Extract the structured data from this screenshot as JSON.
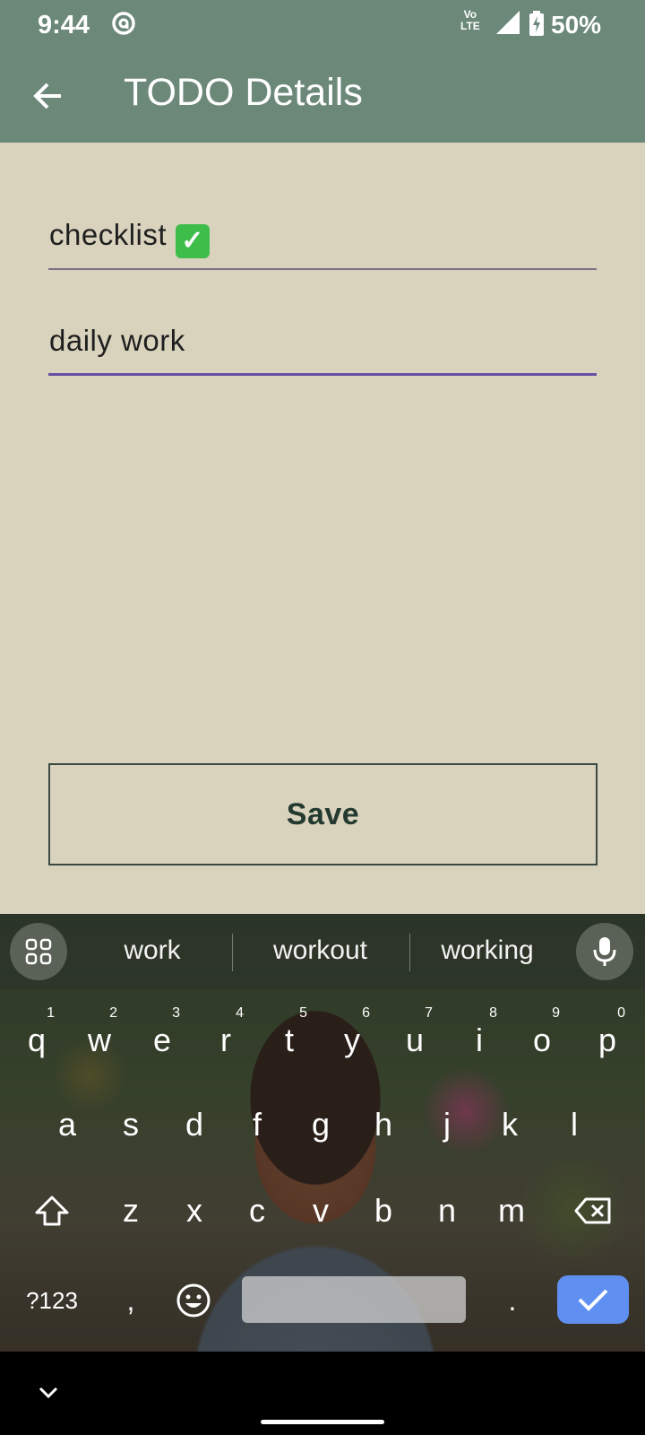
{
  "status_bar": {
    "time": "9:44",
    "volte_top": "Vo",
    "volte_bottom": "LTE",
    "battery": "50%"
  },
  "app_bar": {
    "title": "TODO Details",
    "back_icon": "arrow-left-icon"
  },
  "form": {
    "title_value": "checklist",
    "title_emoji": "✓",
    "description_value": "daily work",
    "save_label": "Save"
  },
  "keyboard": {
    "suggestions": [
      "work",
      "workout",
      "working"
    ],
    "row1": [
      {
        "key": "q",
        "num": "1"
      },
      {
        "key": "w",
        "num": "2"
      },
      {
        "key": "e",
        "num": "3"
      },
      {
        "key": "r",
        "num": "4"
      },
      {
        "key": "t",
        "num": "5"
      },
      {
        "key": "y",
        "num": "6"
      },
      {
        "key": "u",
        "num": "7"
      },
      {
        "key": "i",
        "num": "8"
      },
      {
        "key": "o",
        "num": "9"
      },
      {
        "key": "p",
        "num": "0"
      }
    ],
    "row2": [
      "a",
      "s",
      "d",
      "f",
      "g",
      "h",
      "j",
      "k",
      "l"
    ],
    "row3": [
      "z",
      "x",
      "c",
      "v",
      "b",
      "n",
      "m"
    ],
    "symbols_label": "?123",
    "comma": ",",
    "period": ".",
    "colors": {
      "enter_key": "#5f8ff0"
    }
  },
  "colors": {
    "app_bar": "#6b8878",
    "background": "#d9d2bd",
    "focus_underline": "#6750a4"
  }
}
